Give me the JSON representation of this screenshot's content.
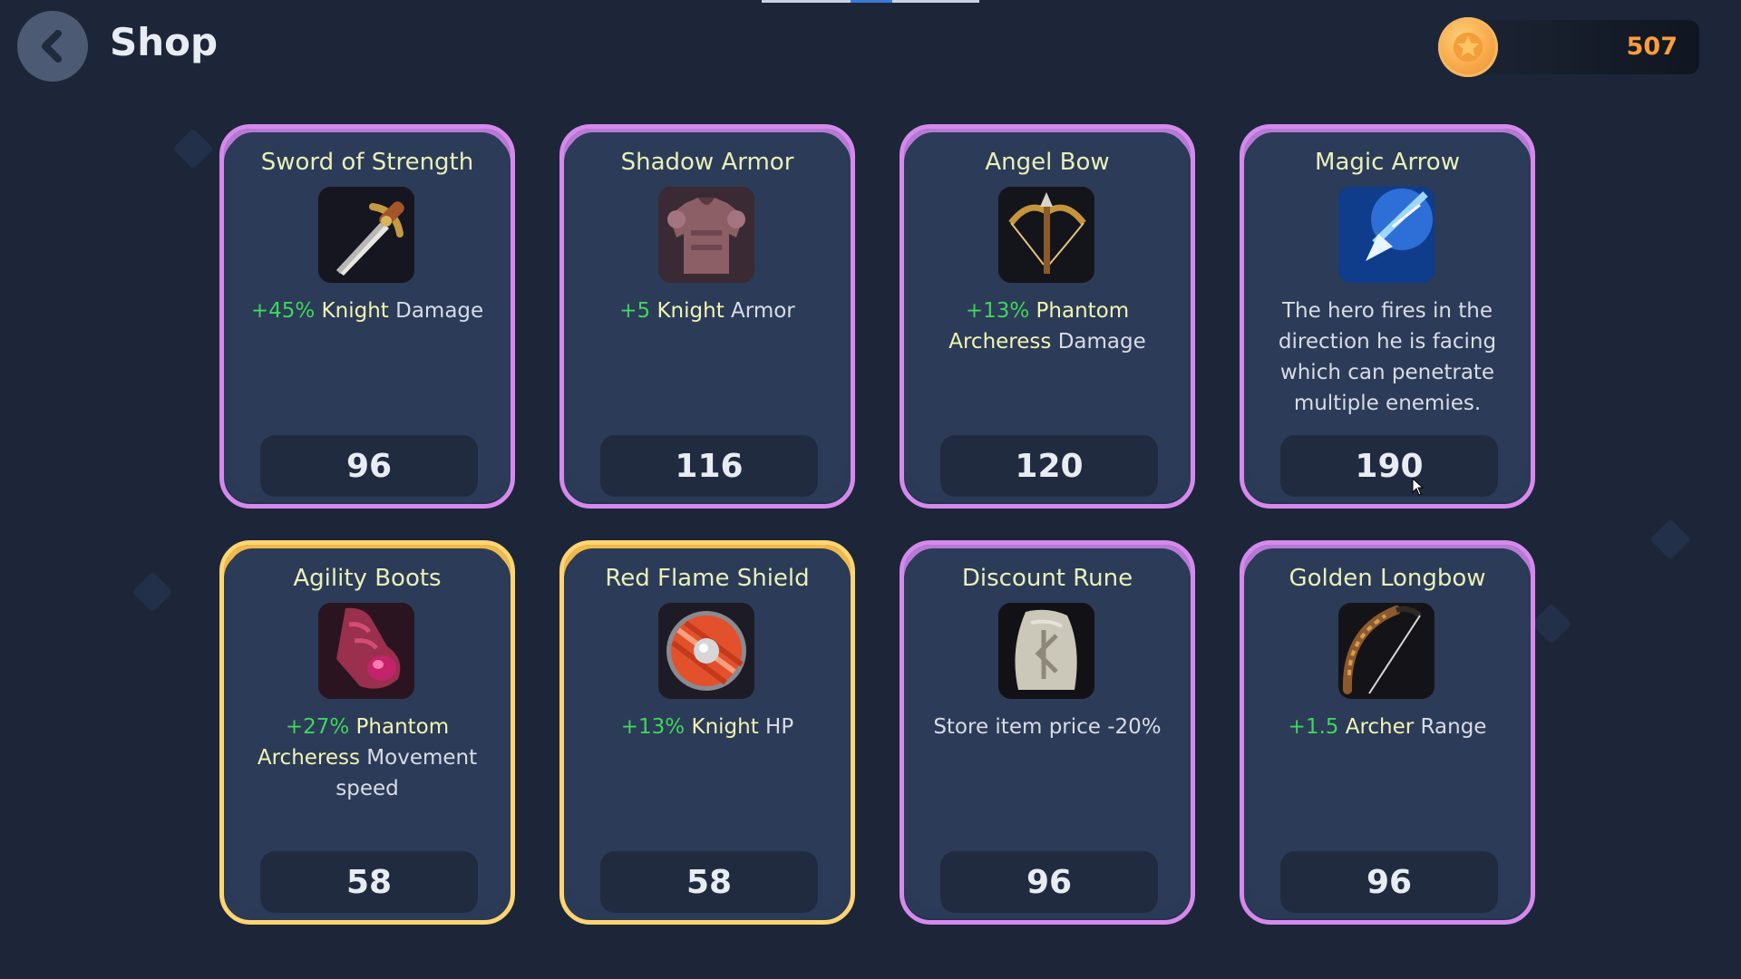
{
  "header": {
    "title": "Shop",
    "back_icon": "chevron-left-icon"
  },
  "currency": {
    "amount": "507",
    "icon": "star-coin-icon",
    "amount_color": "#ff9d3a"
  },
  "colors": {
    "epic_frame": "#d689ec",
    "legendary_frame": "#ffd572",
    "bonus_text": "#3fd65c",
    "hero_text": "#f1f4b3"
  },
  "items": [
    {
      "title": "Sword of Strength",
      "icon": "sword-icon",
      "bonus": "+45%",
      "hero": "Knight",
      "desc": "Damage",
      "price": "96",
      "rarity": "epic"
    },
    {
      "title": "Shadow Armor",
      "icon": "armor-icon",
      "bonus": "+5",
      "hero": "Knight",
      "desc": "Armor",
      "price": "116",
      "rarity": "epic"
    },
    {
      "title": "Angel Bow",
      "icon": "crossbow-icon",
      "bonus": "+13%",
      "hero": "Phantom Archeress",
      "desc": "Damage",
      "price": "120",
      "rarity": "epic"
    },
    {
      "title": "Magic Arrow",
      "icon": "magic-arrow-icon",
      "bonus": "",
      "hero": "",
      "desc": "The hero fires in the direction he is facing which can penetrate multiple enemies.",
      "price": "190",
      "rarity": "epic"
    },
    {
      "title": "Agility Boots",
      "icon": "boots-icon",
      "bonus": "+27%",
      "hero": "Phantom Archeress",
      "desc": "Movement speed",
      "price": "58",
      "rarity": "legendary"
    },
    {
      "title": "Red Flame Shield",
      "icon": "shield-icon",
      "bonus": "+13%",
      "hero": "Knight",
      "desc": "HP",
      "price": "58",
      "rarity": "legendary"
    },
    {
      "title": "Discount Rune",
      "icon": "rune-stone-icon",
      "bonus": "",
      "hero": "",
      "desc": "Store item price -20%",
      "price": "96",
      "rarity": "epic"
    },
    {
      "title": "Golden Longbow",
      "icon": "longbow-icon",
      "bonus": "+1.5",
      "hero": "Archer",
      "desc": "Range",
      "price": "96",
      "rarity": "epic"
    }
  ]
}
